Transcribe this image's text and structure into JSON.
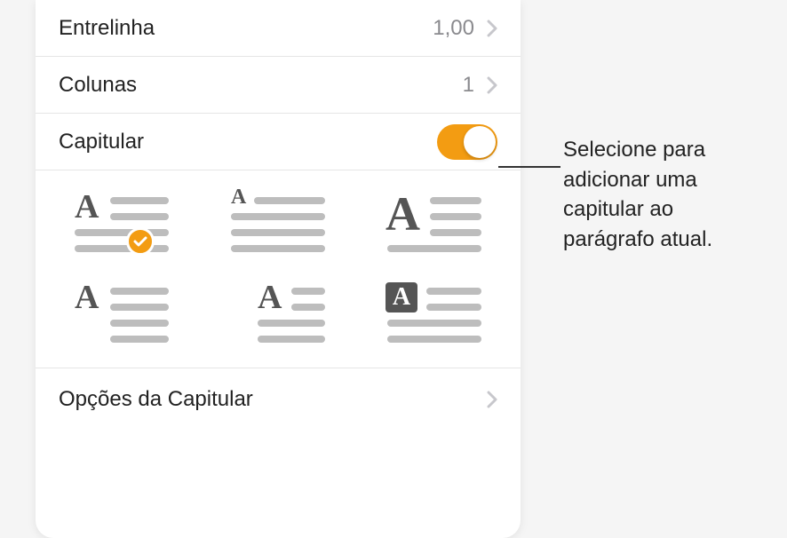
{
  "rows": {
    "lineSpacing": {
      "label": "Entrelinha",
      "value": "1,00"
    },
    "columns": {
      "label": "Colunas",
      "value": "1"
    },
    "dropCap": {
      "label": "Capitular"
    },
    "options": {
      "label": "Opções da Capitular"
    }
  },
  "callout": {
    "text": "Selecione para adicionar uma capitular ao parágrafo atual."
  },
  "colors": {
    "accent": "#f39c12"
  }
}
